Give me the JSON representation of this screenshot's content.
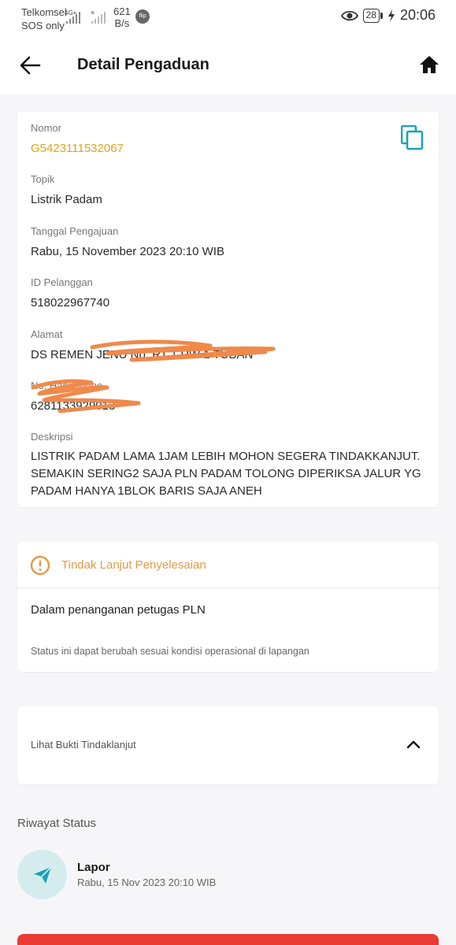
{
  "status_bar": {
    "carrier": "Telkomsel",
    "sos": "SOS only",
    "network": "4G+",
    "speed_value": "621",
    "speed_unit": "B/s",
    "flip_label": "flip",
    "battery": "28",
    "time": "20:06"
  },
  "appbar": {
    "title": "Detail Pengaduan"
  },
  "detail": {
    "nomor_label": "Nomor",
    "nomor_value": "G5423111532067",
    "topik_label": "Topik",
    "topik_value": "Listrik Padam",
    "tanggal_label": "Tanggal Pengajuan",
    "tanggal_value": "Rabu, 15 November 2023 20:10 WIB",
    "idpel_label": "ID Pelanggan",
    "idpel_value": "518022967740",
    "alamat_label": "Alamat",
    "alamat_value": "DS REMEN JENU No. RT 1 RW 1 TUBAN",
    "hp_label": "No. Handphone",
    "hp_value": "6281133929013",
    "deskripsi_label": "Deskripsi",
    "deskripsi_value": "LISTRIK PADAM LAMA 1JAM LEBIH MOHON SEGERA TINDAKKANJUT. SEMAKIN SERING2 SAJA PLN PADAM TOLONG DIPERIKSA JALUR YG PADAM HANYA 1BLOK BARIS SAJA ANEH"
  },
  "tindak_lanjut": {
    "title": "Tindak Lanjut Penyelesaian",
    "status": "Dalam penanganan petugas PLN",
    "note": "Status ini dapat berubah sesuai kondisi operasional di lapangan"
  },
  "bukti": {
    "label": "Lihat Bukti Tindaklanjut"
  },
  "riwayat": {
    "title": "Riwayat Status",
    "items": [
      {
        "title": "Lapor",
        "time": "Rabu, 15 Nov 2023 20:10 WIB"
      }
    ]
  },
  "colors": {
    "accent_orange": "#e3a21a",
    "teal": "#1aa3b3",
    "red_button": "#ea3b34",
    "redaction": "#f0894a"
  },
  "icons": [
    "back-arrow-icon",
    "home-icon",
    "copy-icon",
    "alert-circle-icon",
    "chevron-up-icon",
    "send-icon",
    "eye-icon",
    "bolt-icon"
  ]
}
